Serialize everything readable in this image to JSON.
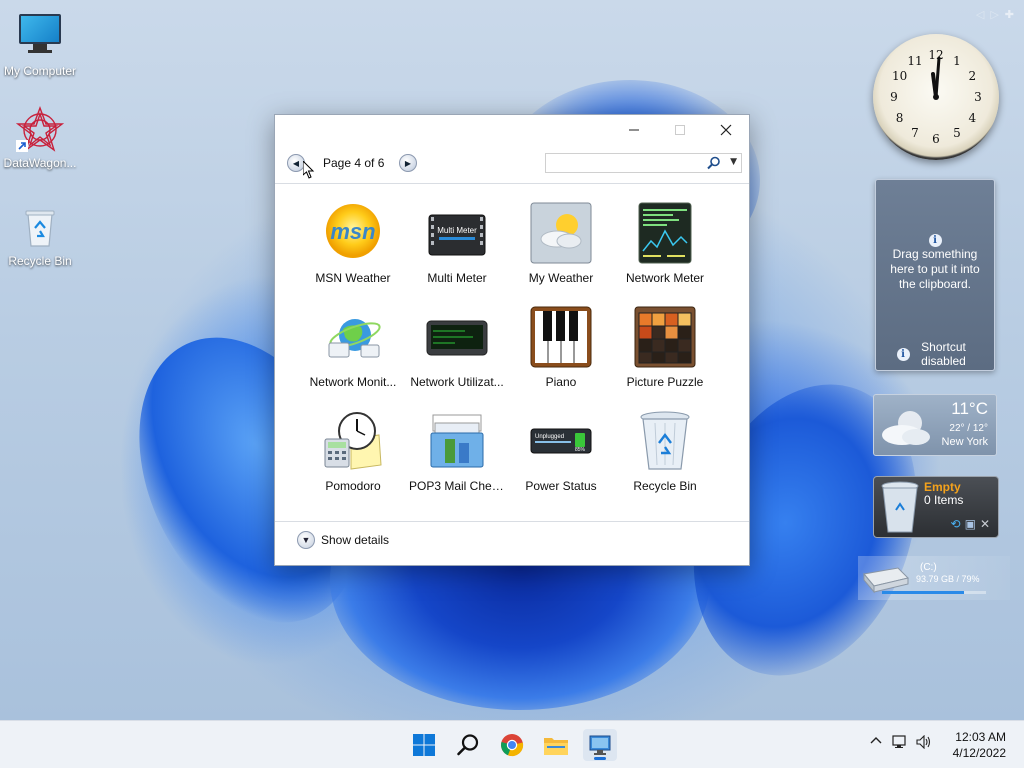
{
  "desktop": {
    "icons": [
      {
        "label": "My Computer"
      },
      {
        "label": "DataWagon..."
      },
      {
        "label": "Recycle Bin"
      }
    ]
  },
  "gadget_gallery": {
    "page_label": "Page 4 of 6",
    "search_placeholder": "",
    "show_details_label": "Show details",
    "gadgets": [
      {
        "label": "MSN Weather",
        "icon": "msn-weather-icon"
      },
      {
        "label": "Multi Meter",
        "icon": "multi-meter-icon"
      },
      {
        "label": "My Weather",
        "icon": "my-weather-icon"
      },
      {
        "label": "Network Meter",
        "icon": "network-meter-icon"
      },
      {
        "label": "Network Monit...",
        "icon": "network-monitor-icon"
      },
      {
        "label": "Network Utilizat...",
        "icon": "network-utilization-icon"
      },
      {
        "label": "Piano",
        "icon": "piano-icon"
      },
      {
        "label": "Picture Puzzle",
        "icon": "picture-puzzle-icon"
      },
      {
        "label": "Pomodoro",
        "icon": "pomodoro-icon"
      },
      {
        "label": "POP3 Mail Chec...",
        "icon": "pop3-mail-icon"
      },
      {
        "label": "Power Status",
        "icon": "power-status-icon"
      },
      {
        "label": "Recycle Bin",
        "icon": "recycle-bin-icon"
      }
    ],
    "multi_meter_text": "Multi Meter",
    "power_status_text": "Unplugged",
    "power_status_pct": "85%"
  },
  "sidebar": {
    "clock_numbers": [
      "12",
      "1",
      "2",
      "3",
      "4",
      "5",
      "6",
      "7",
      "8",
      "9",
      "10",
      "11"
    ],
    "clipboard": {
      "message": "Drag something here to put it into the clipboard.",
      "shortcut": "Shortcut disabled"
    },
    "weather": {
      "temp": "11°C",
      "range": "22° / 12°",
      "city": "New York"
    },
    "recycle": {
      "status": "Empty",
      "items": "0 Items"
    },
    "drive": {
      "label": "(C:)",
      "usage": "93.79 GB / 79%",
      "usage_fraction": 0.79
    }
  },
  "taskbar": {
    "time": "12:03 AM",
    "date": "4/12/2022"
  },
  "colors": {
    "accent": "#1b6fd6",
    "recycle_status": "#f4a21c"
  }
}
